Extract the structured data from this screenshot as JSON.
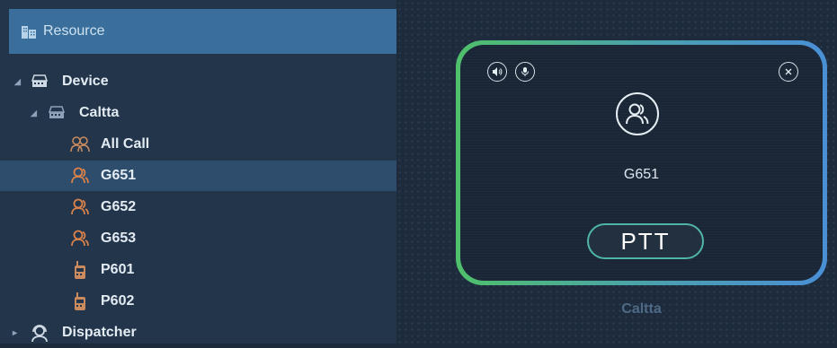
{
  "sidebar": {
    "header": "Resource",
    "tree": [
      {
        "label": "Device",
        "icon": "device-icon"
      },
      {
        "label": "Caltta",
        "icon": "device-icon"
      },
      {
        "label": "All Call",
        "icon": "all-call-icon"
      },
      {
        "label": "G651",
        "icon": "group-icon",
        "selected": true
      },
      {
        "label": "G652",
        "icon": "group-icon"
      },
      {
        "label": "G653",
        "icon": "group-icon"
      },
      {
        "label": "P601",
        "icon": "radio-icon"
      },
      {
        "label": "P602",
        "icon": "radio-icon"
      },
      {
        "label": "Dispatcher",
        "icon": "dispatcher-icon"
      }
    ]
  },
  "call_card": {
    "name": "G651",
    "ptt_label": "PTT",
    "device_label": "Caltta"
  },
  "colors": {
    "accent": "#3a6f9c",
    "border_green": "#4fc06b",
    "border_blue": "#4a8fd6",
    "group_icon": "#d9824a"
  }
}
